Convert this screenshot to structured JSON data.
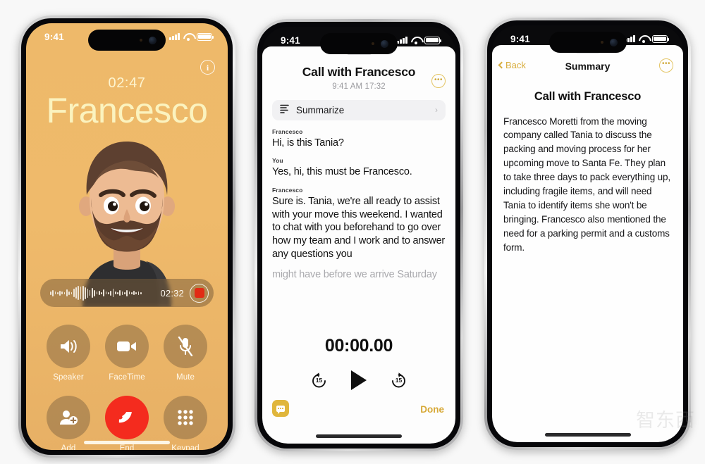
{
  "colors": {
    "page_bg": "#f8f8f8",
    "call_bg": "#efb96a",
    "accent_gold": "#d7a937",
    "end_red": "#f42b1e",
    "name_text": "#fbf3bf"
  },
  "phone1": {
    "status": {
      "time": "9:41",
      "signal": "signal-bars",
      "wifi": "wifi-icon",
      "battery": "battery-icon"
    },
    "info_icon": "info-icon",
    "call_timer": "02:47",
    "caller_name": "Francesco",
    "avatar": "memoji-avatar",
    "recording": {
      "time": "02:32",
      "record_icon": "record-stop-icon",
      "waveform": "audio-waveform"
    },
    "controls": [
      {
        "label": "Speaker",
        "icon": "speaker-icon"
      },
      {
        "label": "FaceTime",
        "icon": "video-camera-icon"
      },
      {
        "label": "Mute",
        "icon": "microphone-muted-icon"
      },
      {
        "label": "Add",
        "icon": "add-person-icon"
      },
      {
        "label": "End",
        "icon": "end-call-icon"
      },
      {
        "label": "Keypad",
        "icon": "keypad-icon"
      }
    ]
  },
  "phone2": {
    "status": {
      "time": "9:41"
    },
    "title": "Call with Francesco",
    "subtitle": "9:41 AM  17:32",
    "more_icon": "more-options-icon",
    "summarize": {
      "label": "Summarize",
      "icon": "summarize-lines-icon",
      "chevron": "chevron-right-icon"
    },
    "transcript": [
      {
        "speaker": "Francesco",
        "text": "Hi, is this Tania?",
        "faded": false
      },
      {
        "speaker": "You",
        "text": "Yes, hi, this must be Francesco.",
        "faded": false
      },
      {
        "speaker": "Francesco",
        "text": "Sure is. Tania, we're all ready to assist with your move this weekend. I wanted to chat with you beforehand to go over how my team and I work and to answer any questions you",
        "faded": false
      },
      {
        "speaker": "",
        "text": "might have before we arrive Saturday",
        "faded": true
      }
    ],
    "player": {
      "time": "00:00.00",
      "rewind_label": "15",
      "rewind_icon": "rewind-15-icon",
      "play_icon": "play-icon",
      "forward_label": "15",
      "forward_icon": "forward-15-icon"
    },
    "chat_icon": "messages-icon",
    "done_label": "Done"
  },
  "phone3": {
    "status": {
      "time": "9:41"
    },
    "back_label": "Back",
    "back_icon": "chevron-left-icon",
    "nav_title": "Summary",
    "more_icon": "more-options-icon",
    "heading": "Call with Francesco",
    "body": "Francesco Moretti from the moving company called Tania to discuss the packing and moving process for her upcoming move to Santa Fe. They plan to take three days to pack everything up, including fragile items, and will need Tania to identify items she won't be bringing. Francesco also mentioned the need for a parking permit and a customs form."
  },
  "watermark": "智东西"
}
